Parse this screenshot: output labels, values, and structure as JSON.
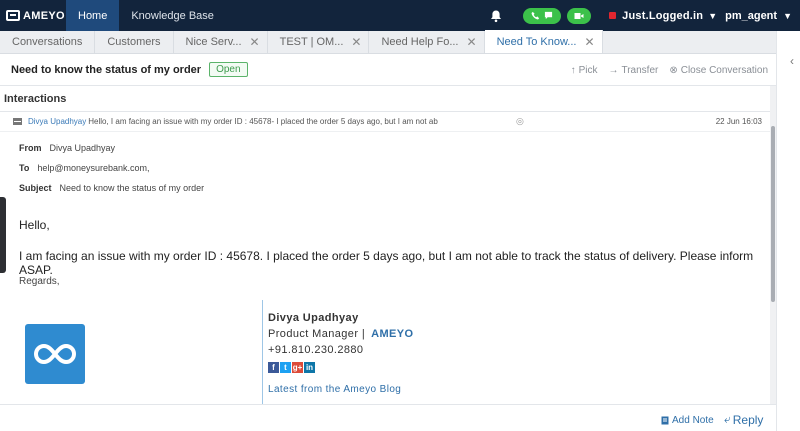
{
  "topbar": {
    "logo_text": "AMEYO",
    "nav": [
      {
        "label": "Home"
      },
      {
        "label": "Knowledge Base"
      }
    ],
    "status": "Just.Logged.in",
    "user": "pm_agent"
  },
  "tabs": [
    {
      "label": "Conversations",
      "closable": false
    },
    {
      "label": "Customers",
      "closable": false
    },
    {
      "label": "Nice Serv...",
      "closable": true
    },
    {
      "label": "TEST | OM...",
      "closable": true
    },
    {
      "label": "Need Help Fo...",
      "closable": true
    },
    {
      "label": "Need To Know...",
      "closable": true
    }
  ],
  "conversation": {
    "title": "Need to know the status of my order",
    "status_badge": "Open",
    "actions": {
      "pick": "Pick",
      "transfer": "Transfer",
      "close": "Close Conversation"
    }
  },
  "interactions": {
    "label": "Interactions",
    "mail": {
      "sender": "Divya Upadhyay",
      "preview": "Hello, I am facing an issue with my order ID : 45678- I placed the order 5 days ago, but I am not ab",
      "date": "22 Jun 16:03",
      "from_label": "From",
      "from": "Divya Upadhyay",
      "to_label": "To",
      "to": "help@moneysurebank.com,",
      "subject_label": "Subject",
      "subject": "Need to know the status of my order",
      "greeting": "Hello,",
      "body": "I am facing an issue with my order ID : 45678. I placed the order 5 days ago, but I am not able to track the status of delivery. Please inform ASAP.",
      "regards": "Regards,"
    },
    "signature": {
      "name": "Divya Upadhyay",
      "role": "Product Manager |",
      "brand": "AMEYO",
      "phone": "+91.810.230.2880",
      "socials": [
        {
          "label": "f",
          "color": "#3b5998"
        },
        {
          "label": "t",
          "color": "#1da1f2"
        },
        {
          "label": "g+",
          "color": "#dd4b39"
        },
        {
          "label": "in",
          "color": "#0e76a8"
        }
      ],
      "blog": "Latest from the Ameyo Blog"
    }
  },
  "footer": {
    "add_note": "Add Note",
    "reply": "Reply"
  }
}
